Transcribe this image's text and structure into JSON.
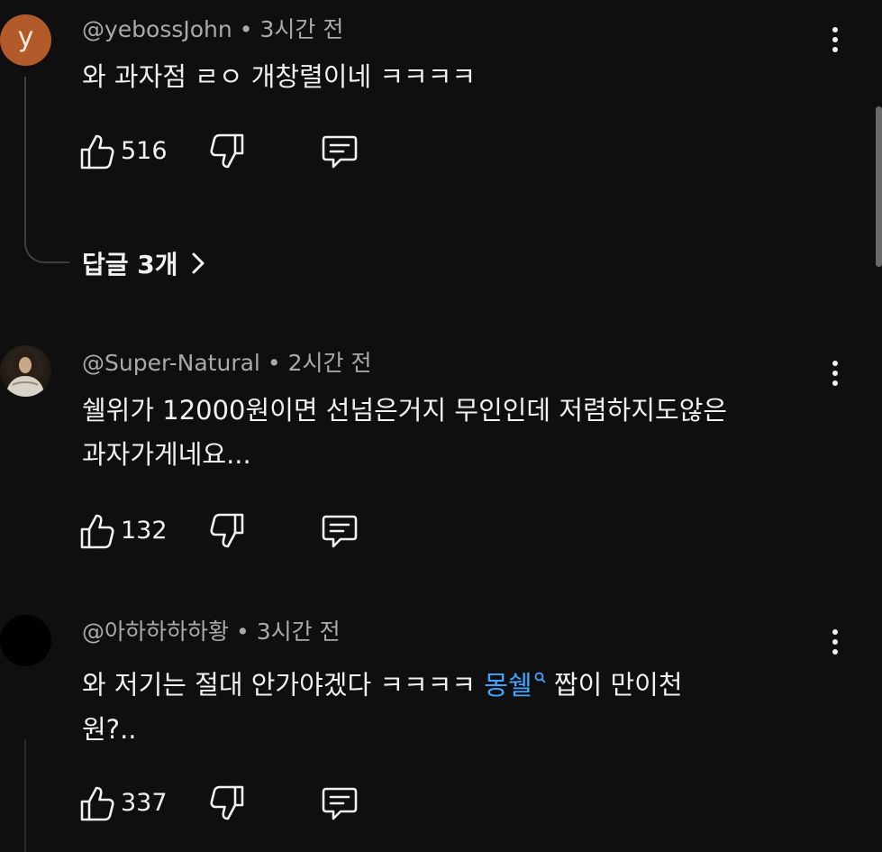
{
  "comments": [
    {
      "avatar_letter": "y",
      "handle": "@yebossJohn",
      "separator": "•",
      "time": "3시간 전",
      "lines": [
        "와 과자점 ㄹㅇ 개창렬이네 ㅋㅋㅋㅋ"
      ],
      "likes": "516",
      "avatar_color": "#b25a2a"
    },
    {
      "handle": "@Super-Natural",
      "separator": "•",
      "time": "2시간 전",
      "lines": [
        "쉘위가 12000원이면 선넘은거지 무인인데 저렴하지도않은",
        "과자가게네요..."
      ],
      "likes": "132"
    },
    {
      "handle": "@아하하하하황",
      "separator": "•",
      "time": "3시간 전",
      "line1_before": "와 저기는 절대 안가야겠다 ㅋㅋㅋㅋ ",
      "line1_link": "몽쉘",
      "line1_after": " 짭이 만이천",
      "line2": "원?..",
      "likes": "337"
    }
  ],
  "replies_label": "답글 3개",
  "icons": {
    "like": "thumbs-up-icon",
    "dislike": "thumbs-down-icon",
    "reply": "reply-icon",
    "more": "more-vert-icon",
    "chevron": "chevron-right-icon",
    "search": "search-icon"
  },
  "colors": {
    "background": "#0f0f0f",
    "text": "#f1f1f1",
    "meta": "#aaaaaa",
    "link": "#3ea6ff"
  }
}
